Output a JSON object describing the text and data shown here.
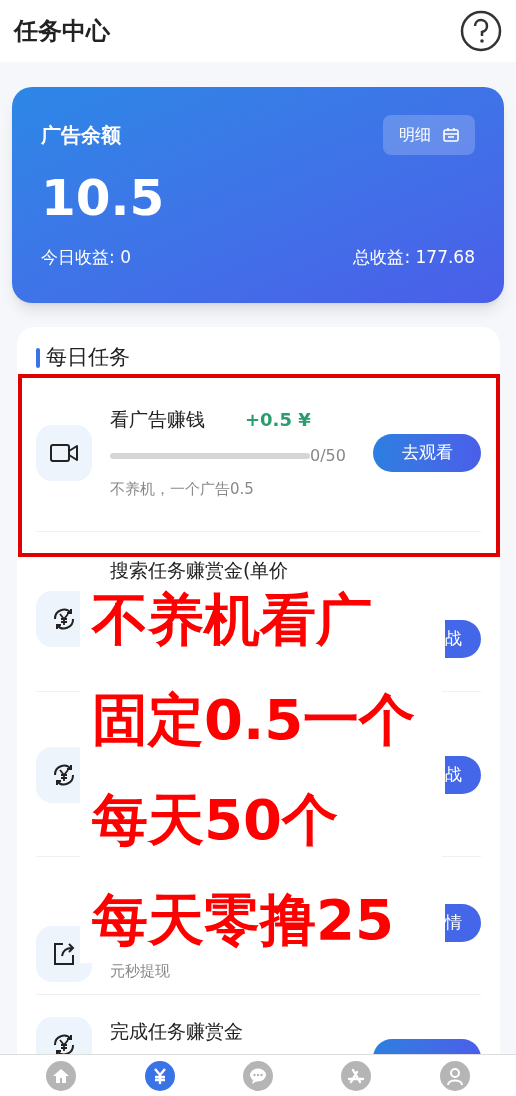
{
  "header": {
    "title": "任务中心"
  },
  "balance": {
    "label": "广告余额",
    "details_button": "明细",
    "amount": "10.5",
    "today": "今日收益: 0",
    "total": "总收益: 177.68"
  },
  "tasks": {
    "title": "每日任务",
    "items": [
      {
        "kind": "video",
        "title": "看广告赚钱",
        "reward": "+0.5 ¥",
        "level": 0,
        "progress_text": "0/50",
        "subtitle": "不养机，一个广告0.5",
        "button": "去观看"
      },
      {
        "kind": "yen-cycle",
        "title": "搜索任务赚赏金(单价",
        "button": "战"
      },
      {
        "kind": "yen-cycle",
        "button": "战"
      },
      {
        "kind": "share",
        "subtitle": "元秒提现",
        "button": "情"
      },
      {
        "kind": "yen-cycle",
        "title": "完成任务赚赏金"
      }
    ]
  },
  "annotation": {
    "lines": [
      "不养机看广",
      "固定0.5一个",
      "每天50个",
      "每天零撸25"
    ]
  },
  "nav": [
    {
      "kind": "home",
      "selected": false
    },
    {
      "kind": "yen",
      "selected": true
    },
    {
      "kind": "chat",
      "selected": false
    },
    {
      "kind": "apps",
      "selected": false
    },
    {
      "kind": "person",
      "selected": false
    }
  ]
}
